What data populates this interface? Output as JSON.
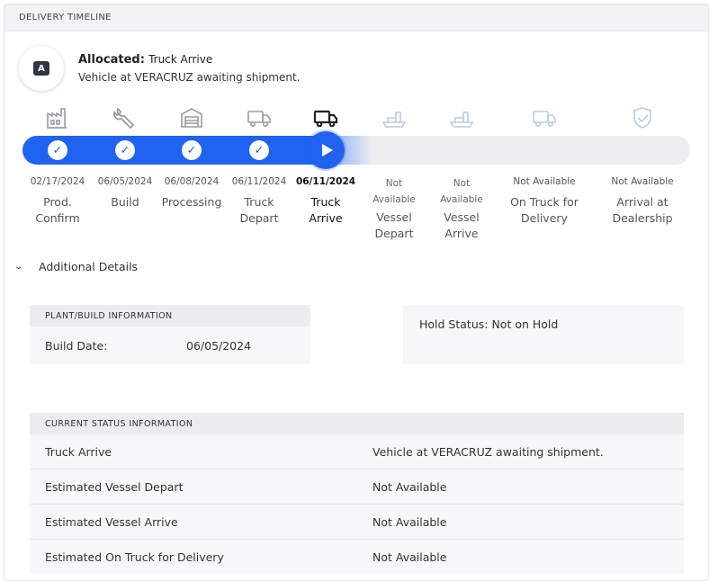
{
  "header": {
    "title": "DELIVERY TIMELINE"
  },
  "status": {
    "icon_letter": "A",
    "label": "Allocated:",
    "value": "Truck Arrive",
    "subtitle": "Vehicle at VERACRUZ awaiting shipment."
  },
  "timeline": {
    "progress_percent": 46.5,
    "stages": [
      {
        "icon": "factory-icon",
        "date": "02/17/2024",
        "label_line1": "Prod.",
        "label_line2": "Confirm",
        "state": "done"
      },
      {
        "icon": "wrench-icon",
        "date": "06/05/2024",
        "label_line1": "Build",
        "label_line2": "",
        "state": "done"
      },
      {
        "icon": "warehouse-icon",
        "date": "06/08/2024",
        "label_line1": "Processing",
        "label_line2": "",
        "state": "done"
      },
      {
        "icon": "truck-icon",
        "date": "06/11/2024",
        "label_line1": "Truck",
        "label_line2": "Depart",
        "state": "done"
      },
      {
        "icon": "truck-icon",
        "date": "06/11/2024",
        "label_line1": "Truck",
        "label_line2": "Arrive",
        "state": "current"
      },
      {
        "icon": "ship-icon",
        "date_line1": "Not",
        "date_line2": "Available",
        "label_line1": "Vessel",
        "label_line2": "Depart",
        "state": "pending"
      },
      {
        "icon": "ship-icon",
        "date_line1": "Not",
        "date_line2": "Available",
        "label_line1": "Vessel",
        "label_line2": "Arrive",
        "state": "pending"
      },
      {
        "icon": "delivery-truck-icon",
        "date": "Not Available",
        "label_line1": "On Truck for",
        "label_line2": "Delivery",
        "state": "pending"
      },
      {
        "icon": "shield-check-icon",
        "date": "Not Available",
        "label_line1": "Arrival at",
        "label_line2": "Dealership",
        "state": "pending"
      }
    ]
  },
  "additional_details": {
    "label": "Additional Details"
  },
  "plant_info": {
    "heading": "PLANT/BUILD INFORMATION",
    "build_date_label": "Build Date:",
    "build_date_value": "06/05/2024"
  },
  "hold": {
    "text": "Hold Status: Not on Hold"
  },
  "current_status": {
    "heading": "CURRENT STATUS INFORMATION",
    "rows": [
      {
        "key": "Truck Arrive",
        "value": "Vehicle at VERACRUZ awaiting shipment."
      },
      {
        "key": "Estimated Vessel Depart",
        "value": "Not Available"
      },
      {
        "key": "Estimated Vessel Arrive",
        "value": "Not Available"
      },
      {
        "key": "Estimated On Truck for Delivery",
        "value": "Not Available"
      }
    ]
  },
  "colors": {
    "accent": "#1f63f0",
    "track": "#edeef2",
    "icon_done": "#9a9ca1",
    "icon_current": "#222222",
    "icon_pending": "#b8cce4"
  }
}
